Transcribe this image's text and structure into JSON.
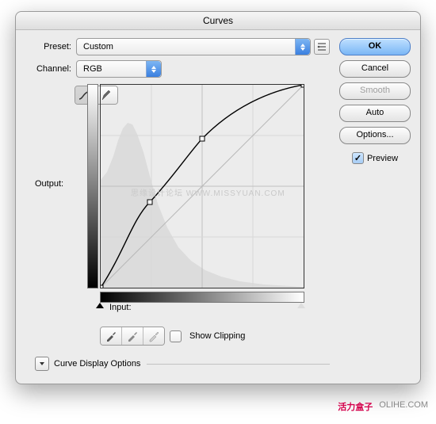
{
  "title": "Curves",
  "preset": {
    "label": "Preset:",
    "value": "Custom"
  },
  "channel": {
    "label": "Channel:",
    "value": "RGB"
  },
  "axes": {
    "output": "Output:",
    "input": "Input:"
  },
  "watermark": "思缘设计论坛  WWW.MISSYUAN.COM",
  "show_clipping": {
    "label": "Show Clipping",
    "checked": false
  },
  "curve_display": "Curve Display Options",
  "buttons": {
    "ok": "OK",
    "cancel": "Cancel",
    "smooth": "Smooth",
    "auto": "Auto",
    "options": "Options..."
  },
  "preview": {
    "label": "Preview",
    "checked": true
  },
  "footer": {
    "brand": "活力盒子",
    "site": "OLIHE.COM"
  },
  "chart_data": {
    "type": "line",
    "title": "Curves",
    "xlabel": "Input",
    "ylabel": "Output",
    "xlim": [
      0,
      255
    ],
    "ylim": [
      0,
      255
    ],
    "points": [
      {
        "x": 0,
        "y": 0
      },
      {
        "x": 62,
        "y": 108
      },
      {
        "x": 128,
        "y": 188
      },
      {
        "x": 255,
        "y": 255
      }
    ],
    "baseline": [
      {
        "x": 0,
        "y": 0
      },
      {
        "x": 255,
        "y": 255
      }
    ]
  }
}
